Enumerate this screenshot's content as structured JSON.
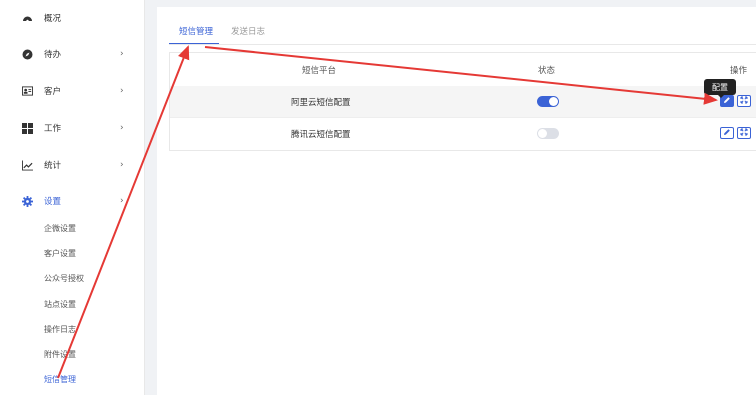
{
  "sidebar": {
    "items": [
      {
        "label": "概况",
        "icon": "dashboard-icon",
        "has_chevron": false
      },
      {
        "label": "待办",
        "icon": "compass-icon",
        "has_chevron": true
      },
      {
        "label": "客户",
        "icon": "id-card-icon",
        "has_chevron": true
      },
      {
        "label": "工作",
        "icon": "grid-icon",
        "has_chevron": true
      },
      {
        "label": "统计",
        "icon": "line-chart-icon",
        "has_chevron": true
      },
      {
        "label": "设置",
        "icon": "gear-icon",
        "has_chevron": true
      }
    ],
    "chevron": "›",
    "sub_items": [
      "企微设置",
      "客户设置",
      "公众号授权",
      "站点设置",
      "操作日志",
      "附件设置",
      "短信管理"
    ]
  },
  "tabs": [
    {
      "label": "短信管理",
      "active": true
    },
    {
      "label": "发送日志",
      "active": false
    }
  ],
  "table": {
    "headers": {
      "platform": "短信平台",
      "status": "状态",
      "actions": "操作"
    },
    "rows": [
      {
        "platform": "阿里云短信配置",
        "status_on": true
      },
      {
        "platform": "腾讯云短信配置",
        "status_on": false
      }
    ]
  },
  "tooltip": {
    "text": "配置"
  },
  "colors": {
    "accent": "#3b63d6",
    "annotation": "#e53935"
  }
}
